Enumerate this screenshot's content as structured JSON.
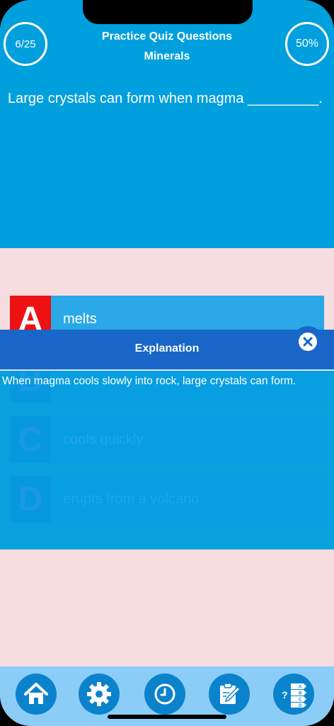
{
  "header": {
    "progress": "6/25",
    "score": "50%",
    "title": "Practice Quiz Questions",
    "subtitle": "Minerals",
    "question": "Large crystals can form when magma _________."
  },
  "answers": [
    {
      "letter": "A",
      "text": "melts",
      "selected": true
    },
    {
      "letter": "B",
      "text": ""
    },
    {
      "letter": "C",
      "text": "cools quickly"
    },
    {
      "letter": "D",
      "text": "erupts from a volcano"
    }
  ],
  "explanation": {
    "title": "Explanation",
    "text": "When magma cools slowly into rock, large crystals can form."
  },
  "nav": {
    "items": [
      "home-icon",
      "gear-icon",
      "clock-icon",
      "notes-icon",
      "quiz-list-icon"
    ]
  },
  "colors": {
    "primary": "#009fdd",
    "selected_letter": "#ee1111",
    "explanation_bar": "#1866c8",
    "background": "#f5dde0",
    "nav_bar": "#8ccdf7",
    "nav_button": "#0a83cc"
  }
}
